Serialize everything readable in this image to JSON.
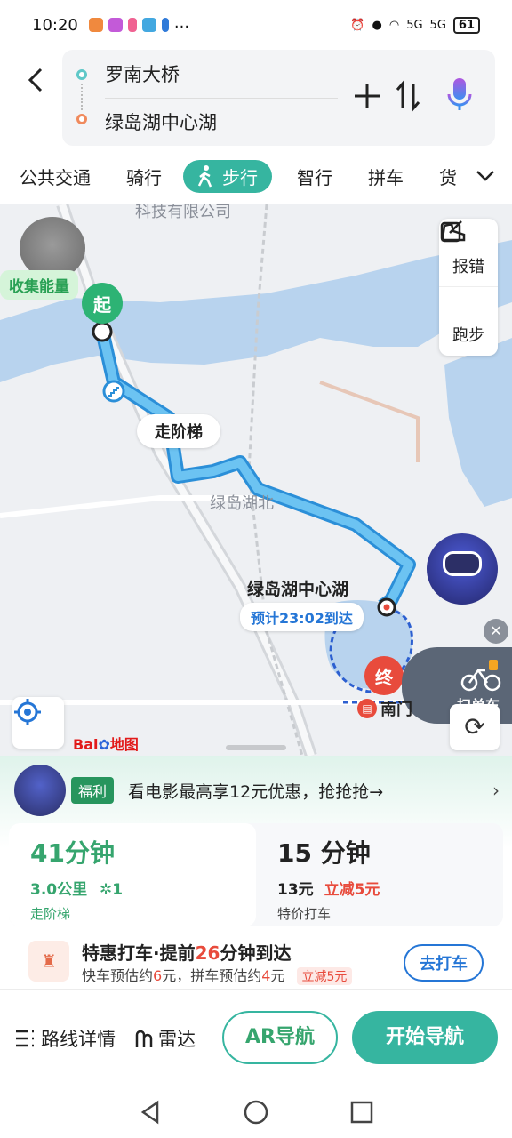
{
  "status": {
    "time": "10:20",
    "battery": "61",
    "signal1": "5G",
    "signal2": "5G"
  },
  "route": {
    "start": "罗南大桥",
    "end": "绿岛湖中心湖"
  },
  "modes": [
    "公共交通",
    "骑行",
    "步行",
    "智行",
    "拼车",
    "货"
  ],
  "active_mode": "步行",
  "map": {
    "energy_label": "收集能量",
    "tools": [
      {
        "label": "报错",
        "icon": "report-icon"
      },
      {
        "label": "跑步",
        "icon": "running-shoe-icon"
      }
    ],
    "start_pin": "起",
    "end_pin": "终",
    "stairs_label": "走阶梯",
    "poi_company": "科技有限公司",
    "poi_north": "绿岛湖北",
    "dest_name": "绿岛湖中心湖",
    "eta": "预计23:02到达",
    "scan_label": "扫单车",
    "south_gate": "南门",
    "logo_a": "Bai",
    "logo_b": "地图"
  },
  "promo": {
    "tag": "福利",
    "text": "看电影最高享12元优惠，抢抢抢→"
  },
  "options": [
    {
      "duration": "41分钟",
      "meta": "3.0公里",
      "lights": "1",
      "sub": "走阶梯"
    },
    {
      "duration": "15 分钟",
      "price": "13元",
      "discount": "立减5元",
      "sub": "特价打车"
    }
  ],
  "taxi": {
    "title_a": "特惠打车·提前",
    "title_num": "26",
    "title_b": "分钟到达",
    "sub_a": "快车预估约",
    "sub_fast": "6",
    "sub_b": "元，拼车预估约",
    "sub_pool": "4",
    "sub_c": "元",
    "tag": "立减5元",
    "button": "去打车"
  },
  "bottom": {
    "details": "路线详情",
    "radar": "雷达",
    "ar": "AR导航",
    "start": "开始导航"
  },
  "colors": {
    "accent": "#36b5a0",
    "route": "#4bb4e6",
    "start_pin": "#2db374",
    "end_pin": "#e84b3c",
    "link_blue": "#2576d6"
  }
}
